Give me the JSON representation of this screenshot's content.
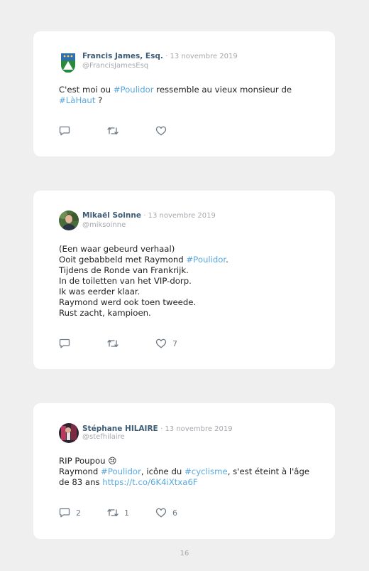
{
  "tweets": [
    {
      "name": "Francis James, Esq.",
      "date": "· 13 novembre 2019",
      "handle": "@FrancisJamesEsq",
      "lines": [
        [
          {
            "t": "C'est moi ou "
          },
          {
            "t": "#Poulidor",
            "tag": true
          },
          {
            "t": " ressemble au vieux monsieur de"
          }
        ],
        [
          {
            "t": "#LàHaut",
            "tag": true
          },
          {
            "t": " ?"
          }
        ]
      ],
      "reply_count": "",
      "retweet_count": "",
      "like_count": ""
    },
    {
      "name": "Mikaël Soinne",
      "date": "· 13 novembre 2019",
      "handle": "@miksoinne",
      "lines": [
        [
          {
            "t": "(Een waar gebeurd verhaal)"
          }
        ],
        [
          {
            "t": "Ooit gebabbeld met Raymond "
          },
          {
            "t": "#Poulidor",
            "tag": true
          },
          {
            "t": "."
          }
        ],
        [
          {
            "t": "Tijdens de Ronde van Frankrijk."
          }
        ],
        [
          {
            "t": "In de toiletten van het VIP-dorp."
          }
        ],
        [
          {
            "t": "Ik was eerder klaar."
          }
        ],
        [
          {
            "t": "Raymond werd ook toen tweede."
          }
        ],
        [
          {
            "t": "Rust zacht, kampioen."
          }
        ]
      ],
      "reply_count": "",
      "retweet_count": "",
      "like_count": "7"
    },
    {
      "name": "Stéphane HILAIRE",
      "date": "· 13 novembre 2019",
      "handle": "@stefhilaire",
      "lines": [
        [
          {
            "t": "RIP Poupou 😢"
          }
        ],
        [
          {
            "t": "Raymond "
          },
          {
            "t": "#Poulidor",
            "tag": true
          },
          {
            "t": ", icône du "
          },
          {
            "t": "#cyclisme",
            "tag": true
          },
          {
            "t": ", s'est éteint à l'âge"
          }
        ],
        [
          {
            "t": "de 83 ans "
          },
          {
            "t": "https://t.co/6K4iXtxa6F",
            "tag": true
          }
        ]
      ],
      "reply_count": "2",
      "retweet_count": "1",
      "like_count": "6"
    }
  ],
  "page_number": "16",
  "colors": {
    "background": "#efefef",
    "card": "#ffffff",
    "name": "#3e5b76",
    "hashtag": "#58a9e0",
    "muted": "#a4a8ad"
  },
  "icons": [
    "reply-icon",
    "retweet-icon",
    "like-icon"
  ]
}
